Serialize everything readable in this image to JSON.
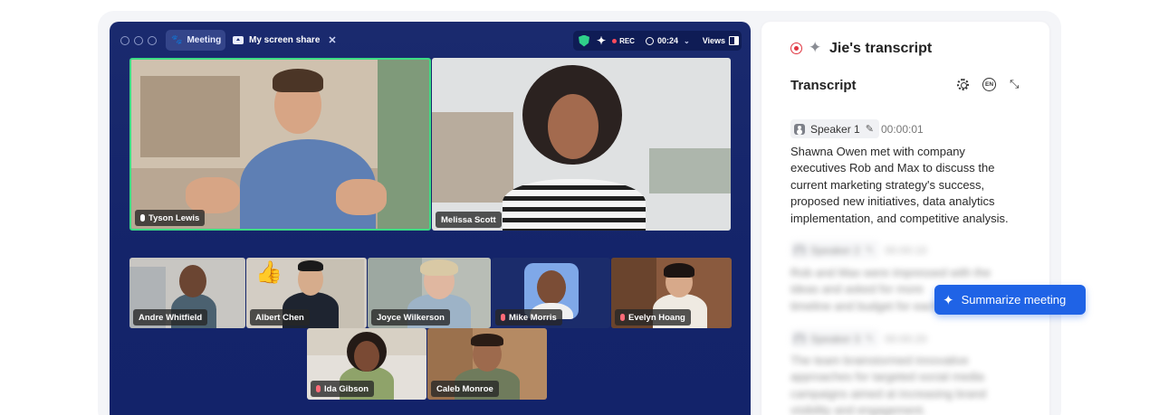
{
  "meeting": {
    "tabs": [
      {
        "label": "Meeting"
      },
      {
        "label": "My screen share"
      }
    ],
    "status": {
      "rec_label": "REC",
      "timer": "00:24",
      "views_label": "Views"
    },
    "speakers": [
      {
        "name": "Tyson Lewis",
        "active": true,
        "muted": false
      },
      {
        "name": "Melissa Scott",
        "active": false,
        "muted": false
      }
    ],
    "participants": [
      {
        "name": "Andre Whitfield",
        "muted": false
      },
      {
        "name": "Albert Chen",
        "muted": false
      },
      {
        "name": "Joyce Wilkerson",
        "muted": false
      },
      {
        "name": "Mike Morris",
        "muted": true
      },
      {
        "name": "Evelyn Hoang",
        "muted": true
      },
      {
        "name": "Ida Gibson",
        "muted": true
      },
      {
        "name": "Caleb Monroe",
        "muted": false
      }
    ],
    "colors": {
      "window_bg": "#1a2a6e",
      "active_border": "#3ddc84",
      "rec_red": "#ff4b5c"
    }
  },
  "transcript": {
    "owner_title": "Jie's transcript",
    "section_title": "Transcript",
    "language": "EN",
    "entries": [
      {
        "speaker": "Speaker 1",
        "time": "00:00:01",
        "text_lines": [
          "Shawna Owen met with company",
          "executives Rob and Max to discuss the",
          "current marketing strategy's success,",
          "proposed new initiatives, data analytics",
          "implementation, and competitive analysis."
        ]
      },
      {
        "speaker": "Speaker 2",
        "time": "00:00:10",
        "text_lines": [
          "Rob and Max were impressed with the",
          "ideas and asked for more",
          "timeline and budget for each"
        ]
      },
      {
        "speaker": "Speaker 3",
        "time": "00:00:20",
        "text_lines": [
          "The team brainstormed innovative",
          "approaches for targeted social media",
          "campaigns aimed at increasing brand",
          "visibility and engagement."
        ]
      }
    ],
    "summarize_label": "Summarize meeting",
    "colors": {
      "accent": "#1f63e6",
      "record": "#e0343f"
    }
  }
}
